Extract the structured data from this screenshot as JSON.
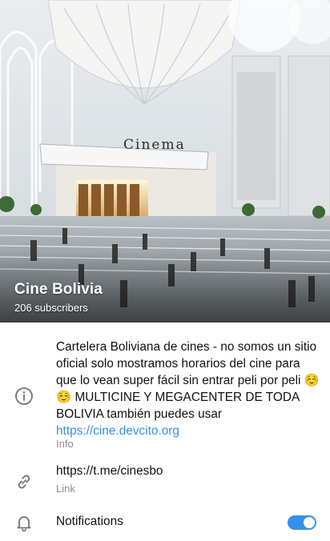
{
  "channel": {
    "title": "Cine Bolivia",
    "subscribers": "206 subscribers",
    "image_sign": "Cinema"
  },
  "info": {
    "description": "Cartelera Boliviana de cines - no somos un sitio oficial solo mostramos horarios del cine para que lo vean super fácil sin entrar peli por peli ☺️☺️ MULTICINE Y MEGACENTER DE TODA BOLIVIA también puedes usar ",
    "description_link": "https://cine.devcito.org",
    "description_label": "Info",
    "link": "https://t.me/cinesbo",
    "link_label": "Link",
    "notifications_label": "Notifications",
    "notifications_on": true
  },
  "icons": {
    "info": "info-circle-icon",
    "link": "link-icon",
    "notifications": "bell-icon"
  },
  "colors": {
    "accent": "#3390ec",
    "secondary_text": "#8c8c8c"
  }
}
